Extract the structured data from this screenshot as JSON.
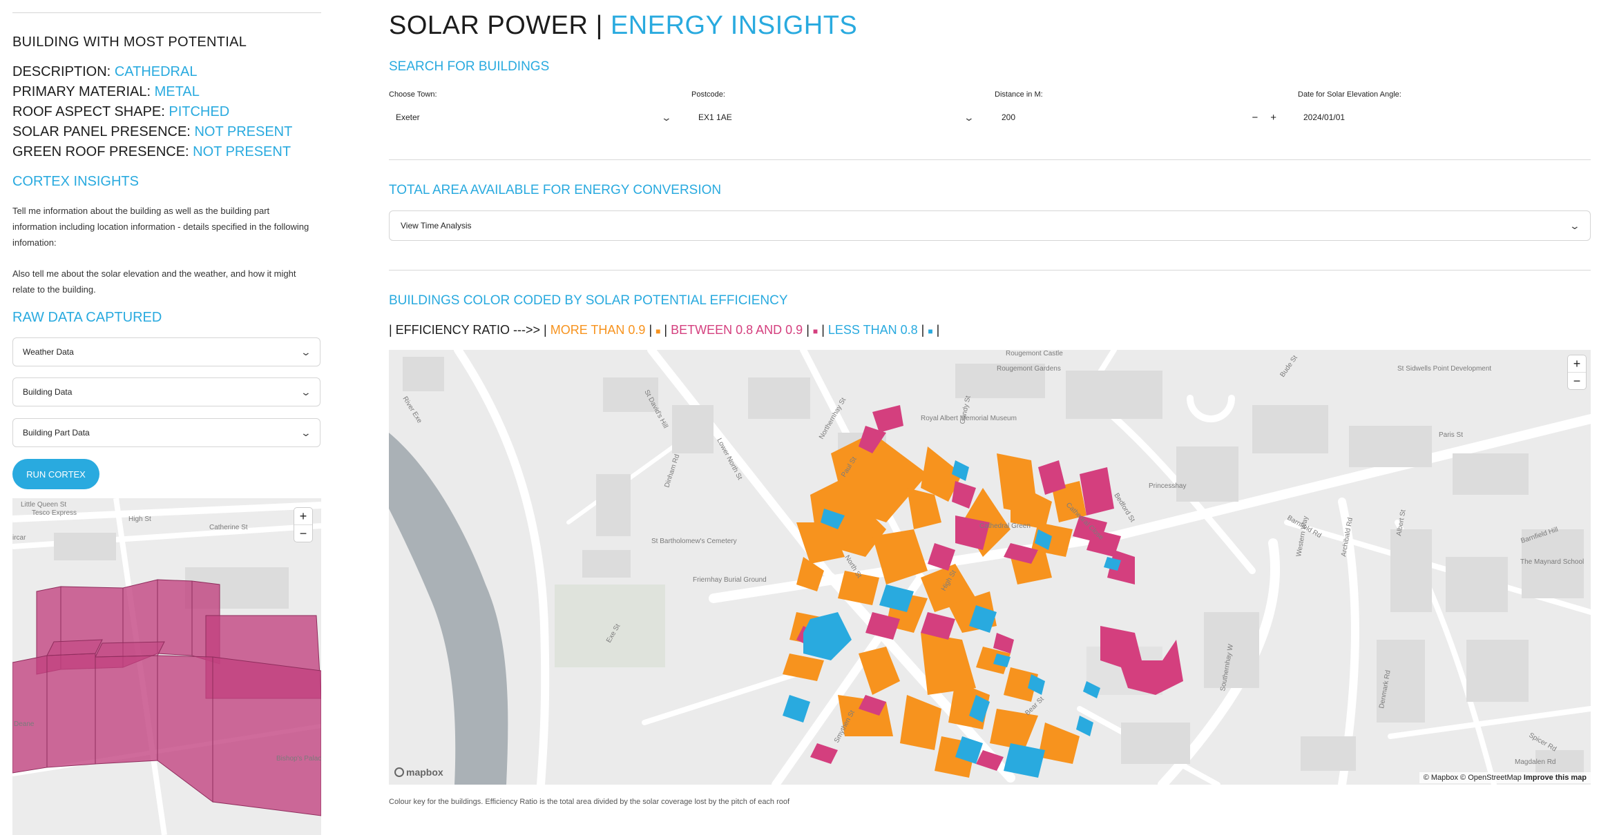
{
  "sidebar": {
    "heading": "BUILDING WITH MOST POTENTIAL",
    "details": [
      {
        "key": "DESCRIPTION:",
        "value": "CATHEDRAL"
      },
      {
        "key": "PRIMARY MATERIAL:",
        "value": "METAL"
      },
      {
        "key": "ROOF ASPECT SHAPE:",
        "value": "PITCHED"
      },
      {
        "key": "SOLAR PANEL PRESENCE:",
        "value": "NOT PRESENT"
      },
      {
        "key": "GREEN ROOF PRESENCE:",
        "value": "NOT PRESENT"
      }
    ],
    "cortex_title": "CORTEX INSIGHTS",
    "cortex_para1": "Tell me information about the building as well as the building part information including location information - details specified in the following infomation:",
    "cortex_para2": "Also tell me about the solar elevation and the weather, and how it might relate to the building.",
    "raw_title": "RAW DATA CAPTURED",
    "expanders": [
      "Weather Data",
      "Building Data",
      "Building Part Data"
    ],
    "run_button": "RUN CORTEX",
    "mini_map_labels": [
      "Little Queen St",
      "Tesco Express",
      "High St",
      "Catherine St",
      "ircar",
      "Deane",
      "Bishop's Palace"
    ],
    "building_color": "#c2417f"
  },
  "header": {
    "title_main": "SOLAR POWER | ",
    "title_accent": "ENERGY INSIGHTS"
  },
  "search": {
    "title": "SEARCH FOR BUILDINGS",
    "town_label": "Choose Town:",
    "town_value": "Exeter",
    "postcode_label": "Postcode:",
    "postcode_value": "EX1 1AE",
    "distance_label": "Distance in M:",
    "distance_value": "200",
    "minus": "−",
    "plus": "+",
    "date_label": "Date for Solar Elevation Angle:",
    "date_value": "2024/01/01"
  },
  "area": {
    "title": "TOTAL AREA AVAILABLE FOR ENERGY CONVERSION",
    "expander": "View Time Analysis"
  },
  "buildings": {
    "title": "BUILDINGS COLOR CODED BY SOLAR POTENTIAL EFFICIENCY",
    "legend_prefix": "| EFFICIENCY RATIO --->> |",
    "legend_more": "MORE THAN 0.9",
    "legend_between": "BETWEEN 0.8 AND 0.9",
    "legend_less": "LESS THAN 0.8",
    "square": "■",
    "sep": "|",
    "colors": {
      "more": "#f7931e",
      "between": "#d43f7e",
      "less": "#29aadf"
    },
    "caption": "Colour key for the buildings. Efficiency Ratio is the total area divided by the solar coverage lost by the pitch of each roof"
  },
  "map": {
    "labels": [
      "River Exe",
      "Rougemont Castle",
      "Rougemont Gardens",
      "Royal Albert Memorial Museum",
      "St Sidwells Point Development",
      "Paris St",
      "Princesshay",
      "Bude St",
      "Northernhay St",
      "Lower North St",
      "St David's Hill",
      "Dinham Rd",
      "Paul St",
      "North St",
      "Bedford St",
      "Western Way",
      "Archibald Rd",
      "Albert St",
      "Barnfield Hill",
      "Barnfield Rd",
      "Cathedral Green",
      "Cathedral Close",
      "St Bartholomew's Cemetery",
      "Friernhay Burial Ground",
      "Exe St",
      "Southernhay W",
      "Denmark Rd",
      "The Maynard School",
      "Spicer Rd",
      "Magdalen Rd",
      "Smythen St",
      "Bear St",
      "High St",
      "Gandy St"
    ],
    "zoom_in": "+",
    "zoom_out": "−",
    "logo": "mapbox",
    "attribution": "© Mapbox © OpenStreetMap",
    "improve": "Improve this map"
  }
}
